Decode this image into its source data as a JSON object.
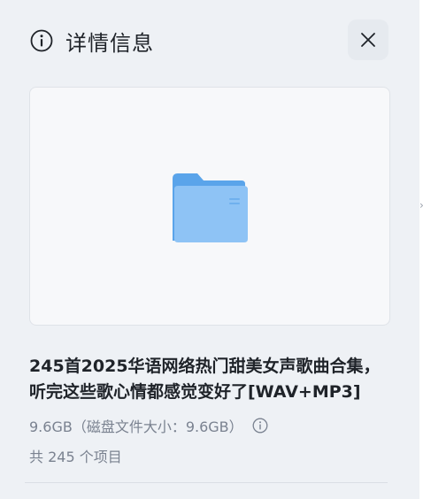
{
  "header": {
    "title": "详情信息",
    "info_icon": "info-circle-icon",
    "close_icon": "close-icon"
  },
  "preview": {
    "icon": "folder-icon",
    "colors": {
      "folder_back": "#5aa4ea",
      "folder_front": "#8ec3f5"
    }
  },
  "item": {
    "name": "245首2025华语网络热门甜美女声歌曲合集，听完这些歌心情都感觉变好了[WAV+MP3]",
    "size_text": "9.6GB（磁盘文件大小：9.6GB）",
    "count_text": "共 245 个项目"
  }
}
